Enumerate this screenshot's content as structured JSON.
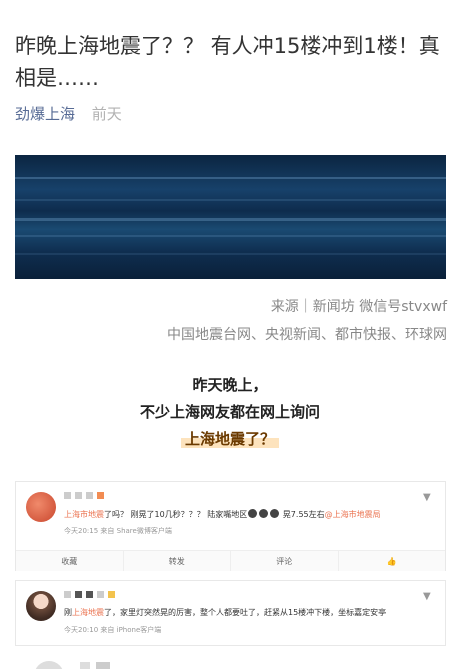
{
  "article": {
    "title": "昨晚上海地震了？？ 有人冲15楼冲到1楼！真相是……",
    "author": "劲爆上海",
    "time": "前天"
  },
  "source": {
    "line1": "来源｜新闻坊 微信号stvxwf",
    "line2": "中国地震台网、央视新闻、都市快报、环球网"
  },
  "quote": {
    "line1": "昨天晚上，",
    "line2": "不少上海网友都在网上询问",
    "line3": "上海地震了？"
  },
  "weibo_posts": [
    {
      "text_prefix": "上海市地震",
      "text_body": "了吗？ 刚晃了10几秒？？？ 陆家嘴地区",
      "text_after": " 晃7.55左右",
      "mention": "@上海市地震局",
      "meta": "今天20:15  来自 Share微博客户端",
      "actions": [
        "收藏",
        "转发",
        "评论",
        "👍"
      ]
    },
    {
      "text_prefix": "刚",
      "text_highlight": "上海地震",
      "text_body": "了，家里灯突然晃的厉害，整个人都要吐了，赶紧从15楼冲下楼，坐标嘉定安亭",
      "meta": "今天20:10  来自 iPhone客户端"
    }
  ],
  "icons": {
    "chevron": "chevron-down-icon",
    "like": "thumbs-up-icon"
  },
  "colors": {
    "author": "#576b95",
    "highlight": "#eb7350",
    "quote_highlight_bg": "#fde3bd"
  }
}
